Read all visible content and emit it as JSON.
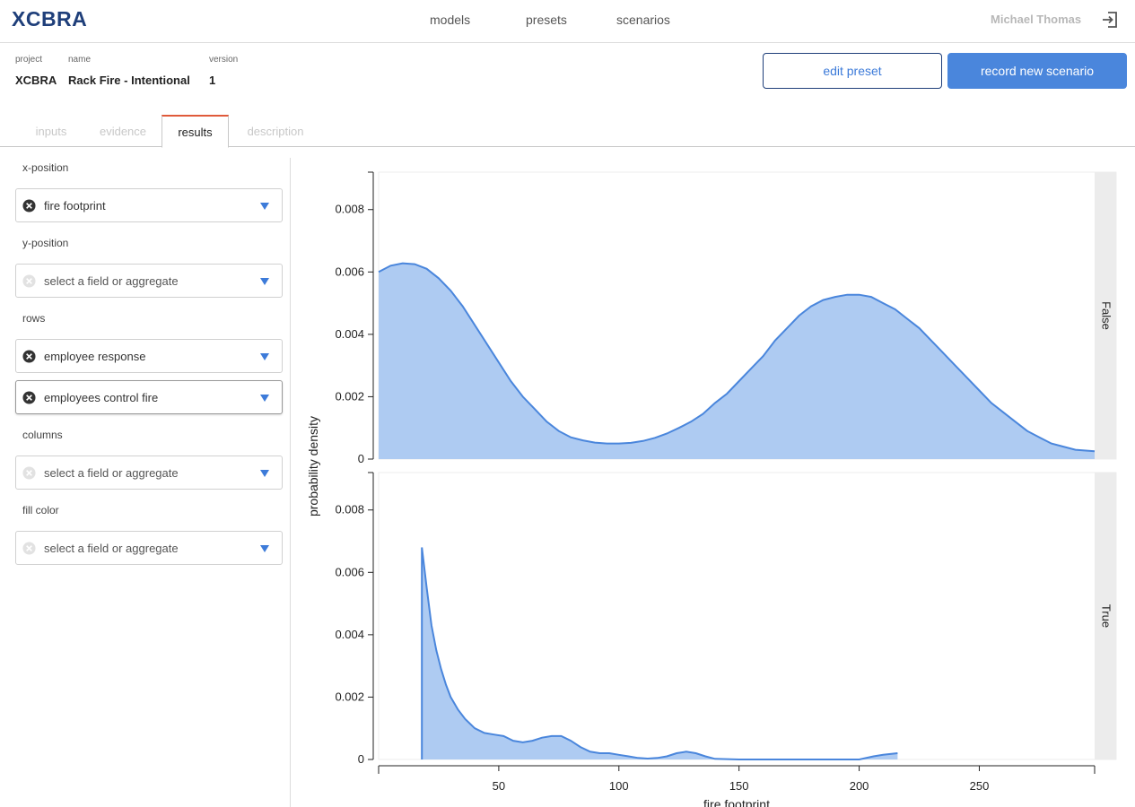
{
  "app": {
    "logo": "XCBRA"
  },
  "nav": {
    "models": "models",
    "presets": "presets",
    "scenarios": "scenarios"
  },
  "user": {
    "name": "Michael Thomas"
  },
  "meta": {
    "project_label": "project",
    "project_value": "XCBRA",
    "name_label": "name",
    "name_value": "Rack Fire - Intentional",
    "version_label": "version",
    "version_value": "1"
  },
  "actions": {
    "edit_preset": "edit preset",
    "record_scenario": "record new scenario"
  },
  "tabs": [
    "inputs",
    "evidence",
    "results",
    "description"
  ],
  "active_tab": "results",
  "fields": {
    "x_position": {
      "label": "x-position",
      "value": "fire footprint"
    },
    "y_position": {
      "label": "y-position",
      "placeholder": "select a field or aggregate"
    },
    "rows": {
      "label": "rows",
      "values": [
        "employee response",
        "employees control fire"
      ]
    },
    "columns": {
      "label": "columns",
      "placeholder": "select a field or aggregate"
    },
    "fill_color": {
      "label": "fill color",
      "placeholder": "select a field or aggregate"
    }
  },
  "colors": {
    "accent": "#4a86dc",
    "area_fill": "#aecbf2",
    "area_stroke": "#4a86dc",
    "tab_highlight": "#e05a3a",
    "logo": "#1f3f7a"
  },
  "chart_data": {
    "type": "area",
    "ylabel": "probability density",
    "xlabel": "fire footprint",
    "xlim": [
      0,
      298
    ],
    "ylim": [
      0,
      0.0092
    ],
    "x_ticks": [
      50,
      100,
      150,
      200,
      250
    ],
    "y_ticks": [
      0,
      0.002,
      0.004,
      0.006,
      0.008
    ],
    "y_tick_labels": [
      "0",
      "0.002",
      "0.004",
      "0.006",
      "0.008"
    ],
    "grid": false,
    "facets": [
      {
        "name": "False",
        "x": [
          0,
          5,
          10,
          15,
          20,
          25,
          30,
          35,
          40,
          45,
          50,
          55,
          60,
          65,
          70,
          75,
          80,
          85,
          90,
          95,
          100,
          105,
          110,
          115,
          120,
          125,
          130,
          135,
          140,
          145,
          150,
          155,
          160,
          165,
          170,
          175,
          180,
          185,
          190,
          195,
          200,
          205,
          210,
          215,
          220,
          225,
          230,
          235,
          240,
          245,
          250,
          255,
          260,
          265,
          270,
          275,
          280,
          285,
          290,
          298
        ],
        "values": [
          0.006,
          0.0062,
          0.00628,
          0.00625,
          0.0061,
          0.0058,
          0.0054,
          0.0049,
          0.0043,
          0.0037,
          0.0031,
          0.0025,
          0.002,
          0.0016,
          0.0012,
          0.0009,
          0.0007,
          0.0006,
          0.00053,
          0.0005,
          0.0005,
          0.00052,
          0.00058,
          0.00068,
          0.00082,
          0.001,
          0.0012,
          0.00145,
          0.0018,
          0.0021,
          0.0025,
          0.0029,
          0.0033,
          0.0038,
          0.0042,
          0.0046,
          0.0049,
          0.0051,
          0.0052,
          0.00527,
          0.00527,
          0.0052,
          0.005,
          0.0048,
          0.0045,
          0.0042,
          0.0038,
          0.0034,
          0.003,
          0.0026,
          0.0022,
          0.0018,
          0.0015,
          0.0012,
          0.0009,
          0.0007,
          0.0005,
          0.0004,
          0.0003,
          0.00025
        ]
      },
      {
        "name": "True",
        "x": [
          18,
          20,
          22,
          24,
          26,
          28,
          30,
          33,
          36,
          40,
          44,
          48,
          52,
          56,
          60,
          64,
          68,
          72,
          76,
          80,
          84,
          88,
          92,
          96,
          100,
          104,
          108,
          112,
          116,
          120,
          124,
          128,
          132,
          136,
          140,
          150,
          160,
          170,
          180,
          190,
          200,
          206,
          210,
          216
        ],
        "values": [
          0.0068,
          0.0055,
          0.0043,
          0.0035,
          0.0029,
          0.0024,
          0.002,
          0.0016,
          0.0013,
          0.001,
          0.00085,
          0.0008,
          0.00075,
          0.0006,
          0.00055,
          0.0006,
          0.0007,
          0.00075,
          0.00075,
          0.0006,
          0.0004,
          0.00025,
          0.0002,
          0.0002,
          0.00015,
          0.0001,
          5e-05,
          3e-05,
          5e-05,
          0.0001,
          0.0002,
          0.00025,
          0.0002,
          0.0001,
          2e-05,
          0.0,
          0.0,
          0.0,
          0.0,
          0.0,
          0.0,
          0.0001,
          0.00015,
          0.0002
        ]
      }
    ]
  }
}
